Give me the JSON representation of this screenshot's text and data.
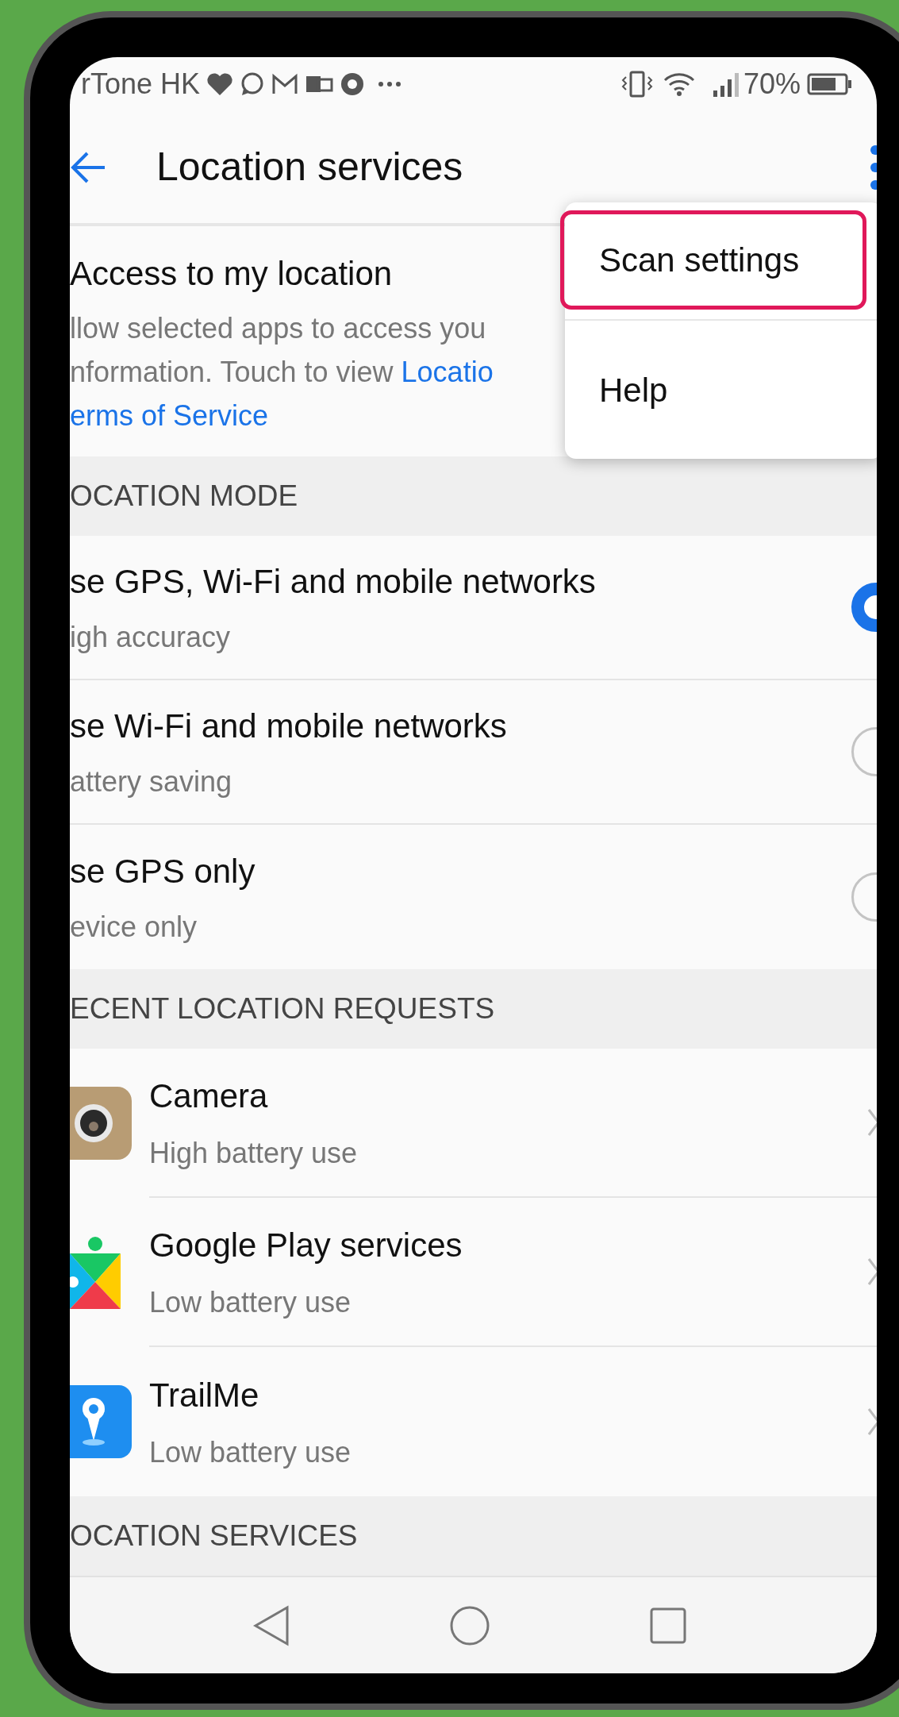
{
  "status_bar": {
    "carrier": "rTone HK",
    "battery": "70%"
  },
  "toolbar": {
    "title": "Location services"
  },
  "menu": {
    "items": [
      {
        "label": "Scan settings",
        "highlighted": true
      },
      {
        "label": "Help",
        "highlighted": false
      }
    ]
  },
  "access": {
    "title": "Access to my location",
    "line_1": "llow selected apps to access you",
    "line_2": "nformation. Touch to view ",
    "line_2_link": "Locatio",
    "line_3_link": "erms of Service"
  },
  "location_mode": {
    "header": "OCATION MODE",
    "options": [
      {
        "title": "se GPS, Wi-Fi and mobile networks",
        "subtitle": "igh accuracy",
        "selected": true
      },
      {
        "title": "se Wi-Fi and mobile networks",
        "subtitle": "attery saving",
        "selected": false
      },
      {
        "title": "se GPS only",
        "subtitle": "evice only",
        "selected": false
      }
    ]
  },
  "recent_requests": {
    "header": "ECENT LOCATION REQUESTS",
    "apps": [
      {
        "kind": "camera",
        "name": "Camera",
        "usage": "High battery use"
      },
      {
        "kind": "play",
        "name": "Google Play services",
        "usage": "Low battery use"
      },
      {
        "kind": "pin",
        "name": "TrailMe",
        "usage": "Low battery use"
      }
    ]
  },
  "location_services": {
    "header": "OCATION SERVICES"
  }
}
